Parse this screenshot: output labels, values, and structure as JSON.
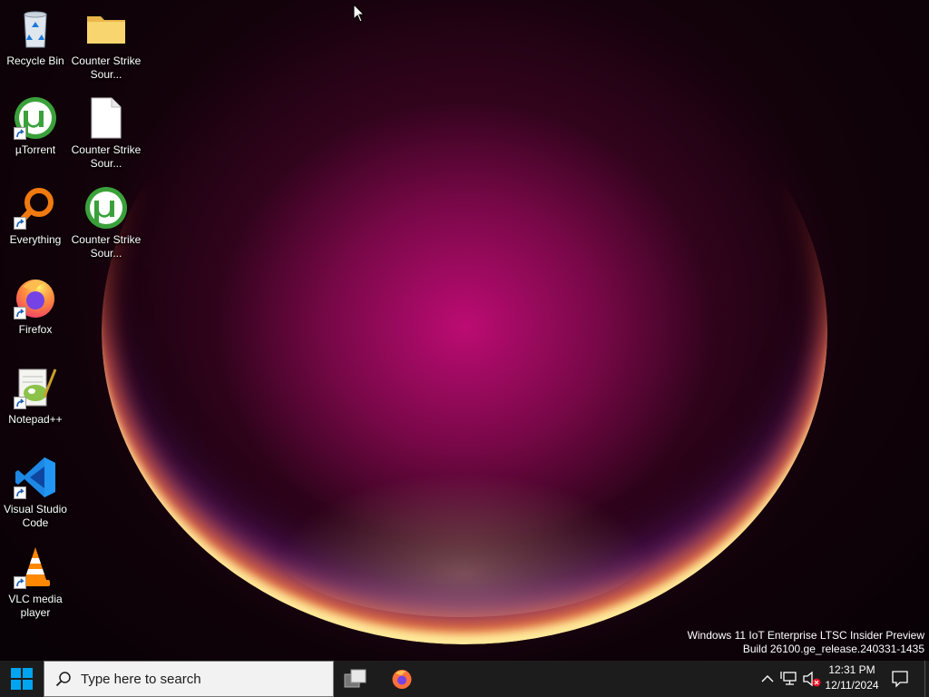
{
  "desktop": {
    "icons": [
      {
        "label": "Recycle Bin",
        "icon": "recycle-bin-icon"
      },
      {
        "label": "µTorrent",
        "icon": "utorrent-icon"
      },
      {
        "label": "Everything",
        "icon": "everything-search-icon"
      },
      {
        "label": "Firefox",
        "icon": "firefox-icon"
      },
      {
        "label": "Notepad++",
        "icon": "notepadpp-icon"
      },
      {
        "label": "Visual Studio Code",
        "icon": "vscode-icon"
      },
      {
        "label": "VLC media player",
        "icon": "vlc-icon"
      },
      {
        "label": "Counter Strike Sour...",
        "icon": "folder-icon"
      },
      {
        "label": "Counter Strike Sour...",
        "icon": "blank-file-icon"
      },
      {
        "label": "Counter Strike Sour...",
        "icon": "utorrent-icon"
      }
    ],
    "watermark": {
      "line1": "Windows 11 IoT Enterprise LTSC Insider Preview",
      "line2": "Build 26100.ge_release.240331-1435"
    }
  },
  "taskbar": {
    "start_icon": "windows-logo-icon",
    "search_placeholder": "Type here to search",
    "pinned": [
      {
        "name": "task-view",
        "icon": "task-view-icon"
      },
      {
        "name": "firefox",
        "icon": "firefox-icon"
      }
    ],
    "tray": {
      "chevron_icon": "chevron-up-icon",
      "network_icon": "network-icon",
      "volume_icon": "volume-muted-icon",
      "time": "12:31 PM",
      "date": "12/11/2024",
      "notification_icon": "notification-icon"
    }
  },
  "colors": {
    "taskbar_bg": "#1c1c1c",
    "search_bg": "#f2f2f2",
    "windows_blue": "#00a4ef",
    "utorrent_green": "#3aa13a"
  }
}
